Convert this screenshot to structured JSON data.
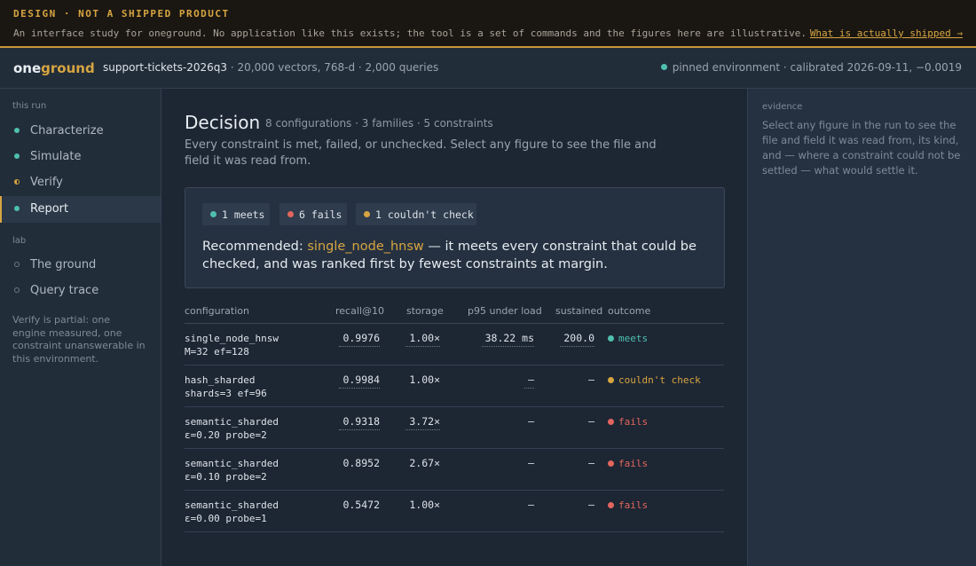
{
  "banner": {
    "title": "DESIGN · NOT A SHIPPED PRODUCT",
    "text": "An interface study for oneground. No application like this exists; the tool is a set of commands and the figures here are illustrative.",
    "link": "What is actually shipped →"
  },
  "header": {
    "logo_a": "one",
    "logo_b": "ground",
    "dataset_name": "support-tickets-2026q3",
    "dataset_meta": "· 20,000 vectors, 768-d · 2,000 queries",
    "environment": "pinned environment · calibrated 2026-09-11, −0.0019"
  },
  "sidebar": {
    "section1": "this run",
    "run_items": [
      {
        "label": "Characterize",
        "status": "done"
      },
      {
        "label": "Simulate",
        "status": "done"
      },
      {
        "label": "Verify",
        "status": "partial"
      },
      {
        "label": "Report",
        "status": "active"
      }
    ],
    "section2": "lab",
    "lab_items": [
      {
        "label": "The ground"
      },
      {
        "label": "Query trace"
      }
    ],
    "note": "Verify is partial: one engine measured, one constraint unanswerable in this environment."
  },
  "main": {
    "title": "Decision",
    "meta": "8 configurations · 3 families · 5 constraints",
    "intro": "Every constraint is met, failed, or unchecked. Select any figure to see the file and field it was read from.",
    "pills": [
      {
        "label": "1 meets",
        "color": "#4ec0ad"
      },
      {
        "label": "6 fails",
        "color": "#e2665e"
      },
      {
        "label": "1 couldn't check",
        "color": "#d7a541"
      }
    ],
    "rec_prefix": "Recommended:",
    "rec_config": "single_node_hnsw",
    "rec_suffix": "— it meets every constraint that could be checked, and was ranked first by fewest constraints at margin."
  },
  "table": {
    "headers": [
      "configuration",
      "recall@10",
      "storage",
      "p95 under load",
      "sustained",
      "outcome"
    ],
    "rows": [
      {
        "name": "single_node_hnsw",
        "params": "M=32 ef=128",
        "recall": "0.9976",
        "storage": "1.00×",
        "p95": "38.22 ms",
        "sustained": "200.0",
        "outcome": "meets"
      },
      {
        "name": "hash_sharded",
        "params": "shards=3 ef=96",
        "recall": "0.9984",
        "storage": "1.00×",
        "p95": "—",
        "sustained": "—",
        "outcome": "couldn't check"
      },
      {
        "name": "semantic_sharded",
        "params": "ε=0.20 probe=2",
        "recall": "0.9318",
        "storage": "3.72×",
        "p95": "—",
        "sustained": "—",
        "outcome": "fails"
      },
      {
        "name": "semantic_sharded",
        "params": "ε=0.10 probe=2",
        "recall": "0.8952",
        "storage": "2.67×",
        "p95": "—",
        "sustained": "—",
        "outcome": "fails"
      },
      {
        "name": "semantic_sharded",
        "params": "ε=0.00 probe=1",
        "recall": "0.5472",
        "storage": "1.00×",
        "p95": "—",
        "sustained": "—",
        "outcome": "fails"
      }
    ]
  },
  "evidence": {
    "label": "evidence",
    "text": "Select any figure in the run to see the file and field it was read from, its kind, and — where a constraint could not be settled — what would settle it."
  },
  "colors": {
    "accent": "#d7a541",
    "meets": "#4ec0ad",
    "fails": "#e2665e",
    "unchecked": "#d7a541"
  }
}
